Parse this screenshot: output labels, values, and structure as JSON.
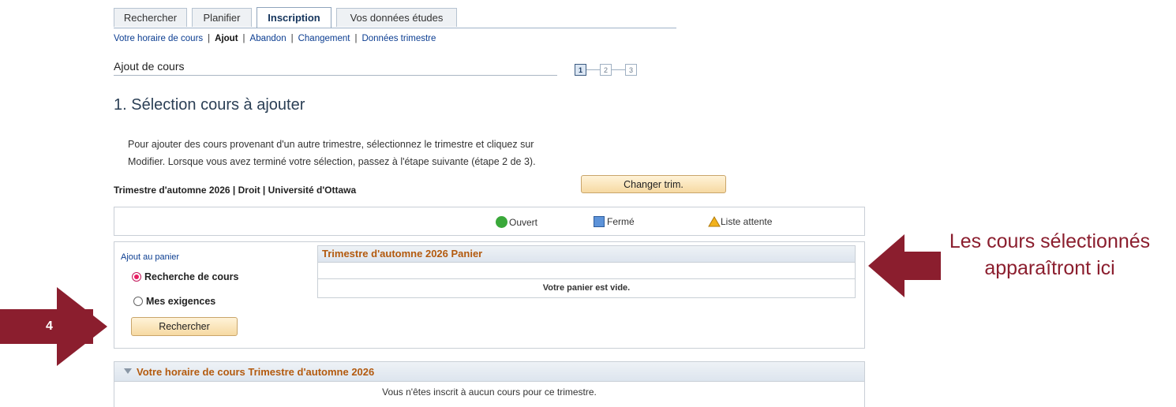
{
  "tabs": [
    {
      "label": "Rechercher"
    },
    {
      "label": "Planifier"
    },
    {
      "label": "Inscription"
    },
    {
      "label": "Vos données études"
    }
  ],
  "subnav": {
    "items": [
      "Votre horaire de cours",
      "Ajout",
      "Abandon",
      "Changement",
      "Données trimestre"
    ],
    "separator": "|"
  },
  "page_heading": "Ajout de cours",
  "steps": [
    "1",
    "2",
    "3"
  ],
  "section_title": "1. Sélection cours à ajouter",
  "instructions": {
    "line1": "Pour ajouter des cours provenant d'un autre trimestre, sélectionnez le trimestre et cliquez sur",
    "line2": "Modifier. Lorsque vous avez terminé votre sélection, passez à l'étape suivante (étape 2 de 3)."
  },
  "term_info": "Trimestre d'automne 2026 | Droit | Université d'Ottawa",
  "change_term_button": "Changer trim.",
  "legend": {
    "open": "Ouvert",
    "closed": "Fermé",
    "waitlist": "Liste attente"
  },
  "add_to_cart": {
    "label": "Ajout au panier",
    "options": [
      "Recherche de cours",
      "Mes exigences"
    ],
    "selected": "Recherche de cours",
    "search_button": "Rechercher"
  },
  "cart": {
    "title": "Trimestre d'automne 2026 Panier",
    "empty_message": "Votre panier est vide."
  },
  "schedule": {
    "title": "Votre horaire de cours Trimestre d'automne 2026",
    "empty_message": "Vous n'êtes inscrit à aucun cours pour ce trimestre."
  },
  "annotations": {
    "callout_text": "Les cours sélectionnés apparaîtront ici",
    "step_badge": "4"
  },
  "colors": {
    "annotation": "#8b1e2e",
    "panel_title": "#b35a0f",
    "open": "#3aa83a",
    "closed": "#5d93d9",
    "waitlist": "#f2b21c"
  }
}
